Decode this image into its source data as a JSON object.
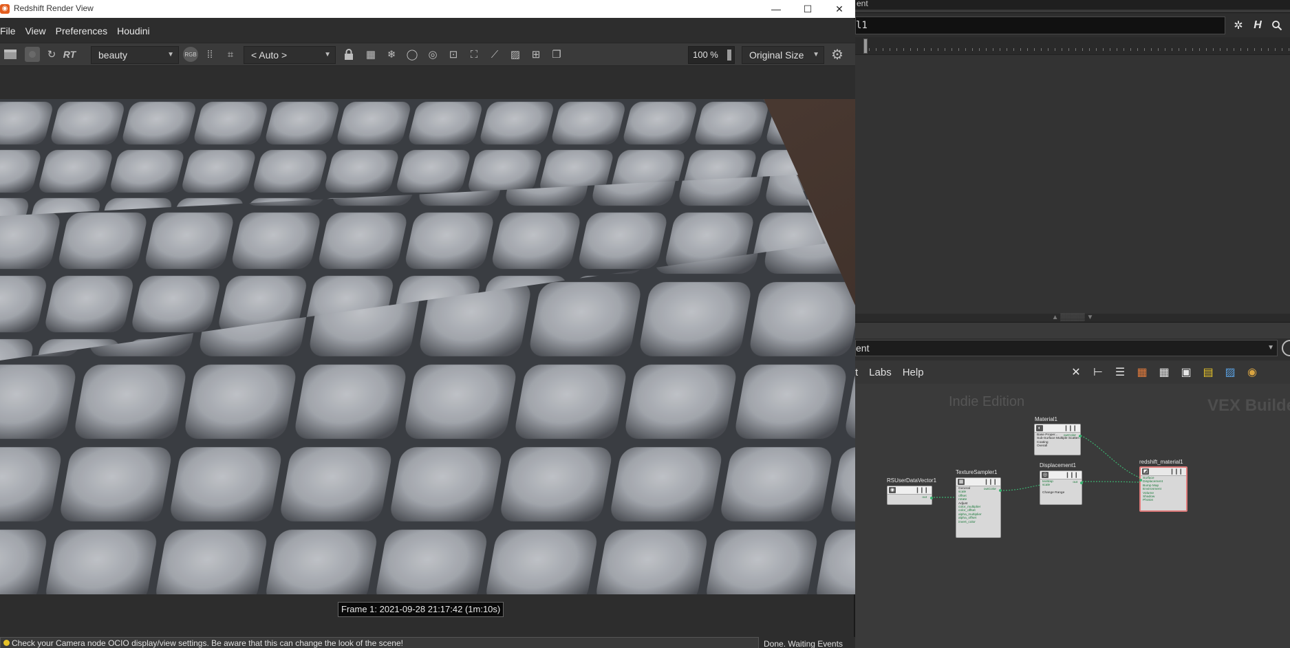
{
  "redshift": {
    "window_title": "Redshift Render View",
    "window_buttons": {
      "minimize": "—",
      "maximize": "☐",
      "close": "✕"
    },
    "menu": [
      "File",
      "View",
      "Preferences",
      "Houdini"
    ],
    "toolbar": {
      "rt_label": "RT",
      "aov_select": "beauty",
      "rgb_label": "RGB",
      "camera_select": "< Auto >",
      "zoom_value": "100 %",
      "size_select": "Original Size"
    },
    "frame_info": "Frame  1:  2021-09-28  21:17:42  (1m:10s)",
    "status_message": "Check your Camera node OCIO display/view settings. Be aware that this can change the look of the scene!",
    "status_right": "Done. Waiting Events"
  },
  "houdini": {
    "top_text": "ent",
    "path_value": "l1",
    "pane2_select": "ent",
    "menu": [
      "t",
      "Labs",
      "Help"
    ],
    "edition_watermark": "Indie Edition",
    "network_label": "VEX Builder",
    "nodes": {
      "material": {
        "name": "Material1",
        "rows": [
          "Base Proper...",
          "Sub-Surface Multiple Scatter...",
          "Coating",
          "Overall"
        ],
        "out": "outColor"
      },
      "userdata": {
        "name": "RSUserDataVector1",
        "out": "out"
      },
      "sampler": {
        "name": "TextureSampler1",
        "rows": [
          "General",
          "scale",
          "offset",
          "rotate",
          "Adjust",
          "color_multiplier",
          "color_offset",
          "alpha_multiplier",
          "alpha_offset",
          "invert_color"
        ],
        "out": "outColor"
      },
      "displacement": {
        "name": "Displacement1",
        "rows": [
          "texMap",
          "scale",
          "Change Range"
        ],
        "out": "out"
      },
      "rsmaterial": {
        "name": "redshift_material1",
        "rows": [
          "Surface",
          "Displacement",
          "Bump Map",
          "Environment",
          "Volume",
          "Shadow",
          "Photon"
        ]
      }
    }
  },
  "colors": {
    "bg_dark": "#2d2d2d",
    "toolbar": "#3a3a3a",
    "render_base": "#8a8d93",
    "wire": "#3cb371",
    "status_dot": "#e6c229"
  }
}
